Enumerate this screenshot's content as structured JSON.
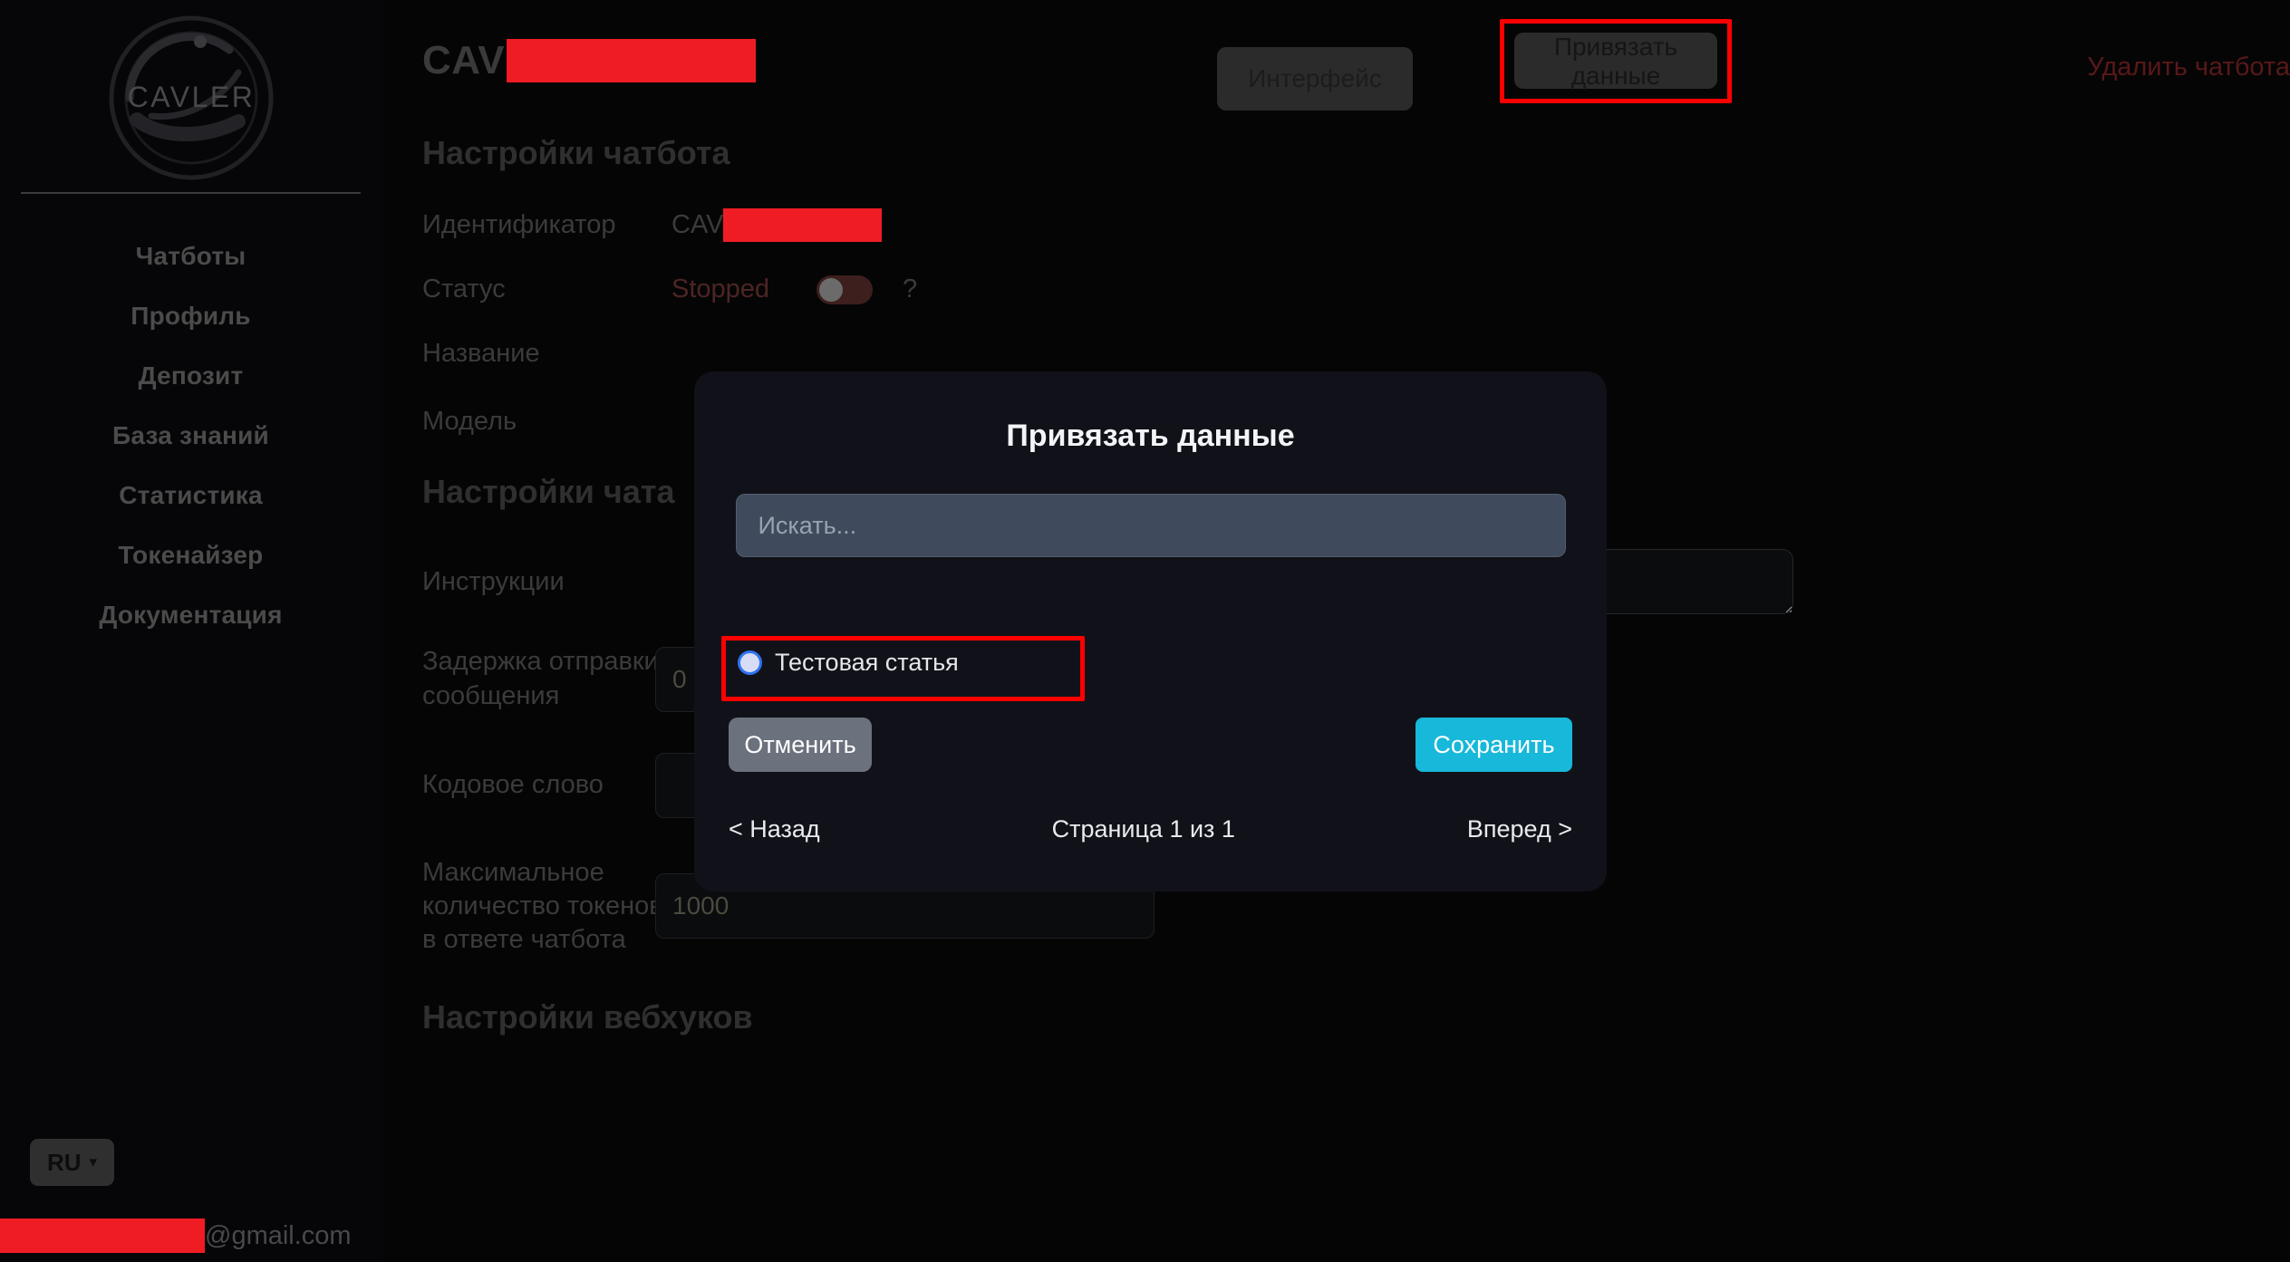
{
  "brand": {
    "name": "CAVLER",
    "logo_icon": "cavler-logo"
  },
  "sidebar": {
    "items": [
      {
        "label": "Чатботы"
      },
      {
        "label": "Профиль"
      },
      {
        "label": "Депозит"
      },
      {
        "label": "База знаний"
      },
      {
        "label": "Статистика"
      },
      {
        "label": "Токенайзер"
      },
      {
        "label": "Документация"
      }
    ],
    "language": {
      "value": "RU",
      "chevron_icon": "chevron-down-icon"
    },
    "user_email_suffix": "@gmail.com"
  },
  "header": {
    "title_prefix": "CAV",
    "interface_button": "Интерфейс",
    "bind_data_button": "Привязать данные",
    "delete_chatbot_link": "Удалить чатбота"
  },
  "chatbot_settings": {
    "section_title": "Настройки чатбота",
    "identifier_label": "Идентификатор",
    "identifier_prefix": "CAV",
    "status_label": "Статус",
    "status_value": "Stopped",
    "status_help": "?",
    "name_label": "Название",
    "model_label": "Модель"
  },
  "chat_settings": {
    "section_title": "Настройки чата",
    "instructions_label": "Инструкции",
    "instructions_value": "",
    "delay_label": "Задержка отправки сообщения",
    "delay_value": "0",
    "codeword_label": "Кодовое слово",
    "codeword_value": "",
    "max_tokens_label": "Максимальное количество токенов в ответе чатбота",
    "max_tokens_value": "1000"
  },
  "webhook_settings": {
    "section_title": "Настройки вебхуков"
  },
  "modal": {
    "title": "Привязать данные",
    "search_placeholder": "Искать...",
    "search_value": "",
    "results": [
      {
        "label": "Тестовая статья",
        "selected": true
      }
    ],
    "cancel_button": "Отменить",
    "save_button": "Сохранить",
    "prev_page": "< Назад",
    "page_indicator": "Страница 1 из 1",
    "next_page": "Вперед >"
  },
  "colors": {
    "accent_save": "#17b8d9",
    "highlight_box": "#ff0000",
    "redaction": "#f01c24",
    "danger_link": "#591818",
    "search_field": "#3f4a5c",
    "modal_bg": "#111219",
    "page_bg": "#050506"
  }
}
